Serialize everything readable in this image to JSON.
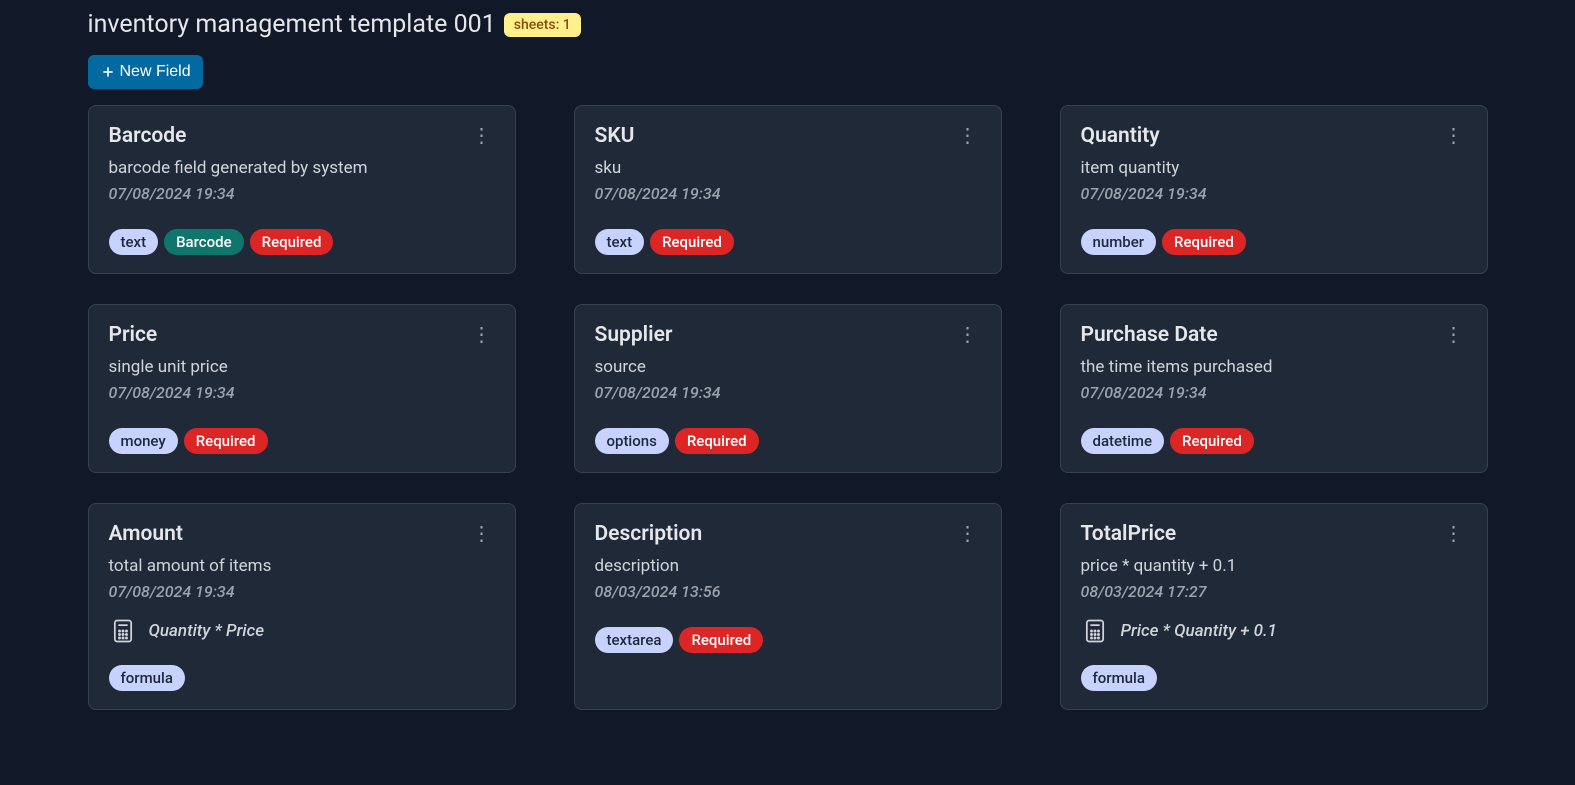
{
  "header": {
    "title": "inventory management template 001",
    "sheets_badge": "sheets: 1"
  },
  "actions": {
    "new_field_label": "New Field"
  },
  "badge_labels": {
    "barcode": "Barcode",
    "required": "Required"
  },
  "fields": [
    {
      "name": "Barcode",
      "description": "barcode field generated by system",
      "date": "07/08/2024 19:34",
      "type": "text",
      "barcode": true,
      "required": true,
      "formula": null
    },
    {
      "name": "SKU",
      "description": "sku",
      "date": "07/08/2024 19:34",
      "type": "text",
      "barcode": false,
      "required": true,
      "formula": null
    },
    {
      "name": "Quantity",
      "description": "item quantity",
      "date": "07/08/2024 19:34",
      "type": "number",
      "barcode": false,
      "required": true,
      "formula": null
    },
    {
      "name": "Price",
      "description": "single unit price",
      "date": "07/08/2024 19:34",
      "type": "money",
      "barcode": false,
      "required": true,
      "formula": null
    },
    {
      "name": "Supplier",
      "description": "source",
      "date": "07/08/2024 19:34",
      "type": "options",
      "barcode": false,
      "required": true,
      "formula": null
    },
    {
      "name": "Purchase Date",
      "description": "the time items purchased",
      "date": "07/08/2024 19:34",
      "type": "datetime",
      "barcode": false,
      "required": true,
      "formula": null
    },
    {
      "name": "Amount",
      "description": "total amount of items",
      "date": "07/08/2024 19:34",
      "type": "formula",
      "barcode": false,
      "required": false,
      "formula": "Quantity * Price"
    },
    {
      "name": "Description",
      "description": "description",
      "date": "08/03/2024 13:56",
      "type": "textarea",
      "barcode": false,
      "required": true,
      "formula": null
    },
    {
      "name": "TotalPrice",
      "description": "price * quantity + 0.1",
      "date": "08/03/2024 17:27",
      "type": "formula",
      "barcode": false,
      "required": false,
      "formula": "Price * Quantity + 0.1"
    }
  ]
}
